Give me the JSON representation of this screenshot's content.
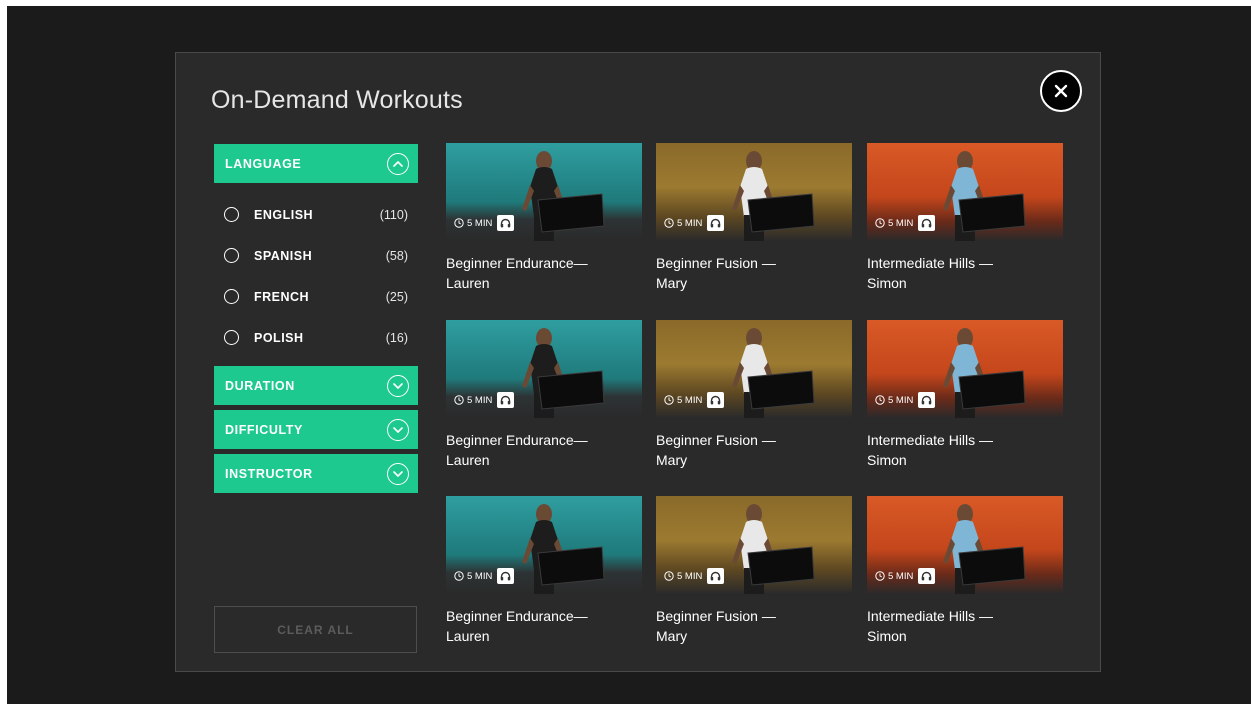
{
  "modal": {
    "title": "On-Demand Workouts",
    "close_icon": "close-icon"
  },
  "filters": {
    "language": {
      "label": "LANGUAGE",
      "expanded": true,
      "options": [
        {
          "name": "ENGLISH",
          "count": "(110)"
        },
        {
          "name": "SPANISH",
          "count": "(58)"
        },
        {
          "name": "FRENCH",
          "count": "(25)"
        },
        {
          "name": "POLISH",
          "count": "(16)"
        }
      ]
    },
    "duration": {
      "label": "DURATION",
      "expanded": false
    },
    "difficulty": {
      "label": "DIFFICULTY",
      "expanded": false
    },
    "instructor": {
      "label": "INSTRUCTOR",
      "expanded": false
    },
    "clear_all": "CLEAR ALL"
  },
  "workouts": [
    {
      "title": "Beginner Endurance—\nLauren",
      "duration": "5 MIN",
      "theme": "teal"
    },
    {
      "title": "Beginner Fusion —\nMary",
      "duration": "5 MIN",
      "theme": "gold"
    },
    {
      "title": "Intermediate Hills —\nSimon",
      "duration": "5 MIN",
      "theme": "orange"
    },
    {
      "title": "Beginner Endurance—\nLauren",
      "duration": "5 MIN",
      "theme": "teal"
    },
    {
      "title": "Beginner Fusion —\nMary",
      "duration": "5 MIN",
      "theme": "gold"
    },
    {
      "title": "Intermediate Hills —\nSimon",
      "duration": "5 MIN",
      "theme": "orange"
    },
    {
      "title": "Beginner Endurance—\nLauren",
      "duration": "5 MIN",
      "theme": "teal"
    },
    {
      "title": "Beginner Fusion —\nMary",
      "duration": "5 MIN",
      "theme": "gold"
    },
    {
      "title": "Intermediate Hills —\nSimon",
      "duration": "5 MIN",
      "theme": "orange"
    }
  ],
  "colors": {
    "accent": "#1ec98f",
    "background": "#1b1b1b",
    "panel": "#2a2a2a"
  }
}
